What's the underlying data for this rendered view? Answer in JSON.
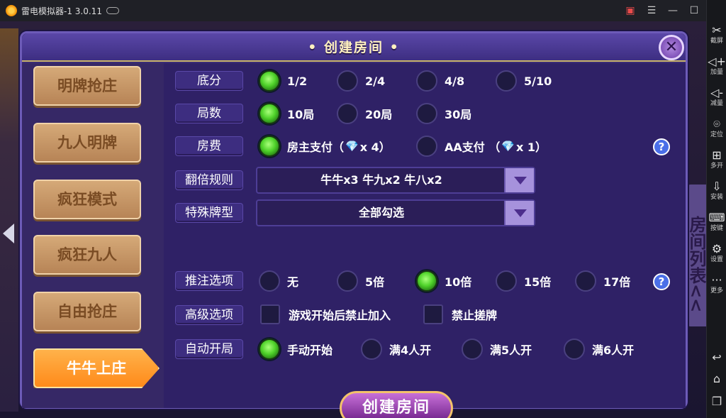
{
  "window": {
    "title": "雷电模拟器-1 3.0.11"
  },
  "dialog": {
    "title": "• 创建房间 •",
    "close_label": "✕",
    "create_button": "创建房间"
  },
  "background": {
    "side_panel_text": "房间列表<<"
  },
  "sidebar": {
    "items": [
      {
        "label": "明牌抢庄",
        "active": false
      },
      {
        "label": "九人明牌",
        "active": false
      },
      {
        "label": "疯狂模式",
        "active": false
      },
      {
        "label": "疯狂九人",
        "active": false
      },
      {
        "label": "自由抢庄",
        "active": false
      },
      {
        "label": "牛牛上庄",
        "active": true
      }
    ]
  },
  "form": {
    "base_score": {
      "label": "底分",
      "options": [
        "1/2",
        "2/4",
        "4/8",
        "5/10"
      ],
      "selected": "1/2"
    },
    "rounds": {
      "label": "局数",
      "options": [
        "10局",
        "20局",
        "30局"
      ],
      "selected": "10局"
    },
    "fee": {
      "label": "房费",
      "options": [
        {
          "text": "房主支付（",
          "gem": "💎",
          "mult": "x 4）"
        },
        {
          "text": "AA支付 （",
          "gem": "💎",
          "mult": "x 1）"
        }
      ],
      "selected": "房主支付",
      "help": "?"
    },
    "double_rule": {
      "label": "翻倍规则",
      "value": "牛牛x3  牛九x2  牛八x2"
    },
    "special": {
      "label": "特殊牌型",
      "value": "全部勾选"
    },
    "bet": {
      "label": "推注选项",
      "options": [
        "无",
        "5倍",
        "10倍",
        "15倍",
        "17倍"
      ],
      "selected": "10倍",
      "help": "?"
    },
    "advanced": {
      "label": "高级选项",
      "options": [
        {
          "label": "游戏开始后禁止加入",
          "checked": false
        },
        {
          "label": "禁止搓牌",
          "checked": false
        }
      ]
    },
    "auto_start": {
      "label": "自动开局",
      "options": [
        "手动开始",
        "满4人开",
        "满5人开",
        "满6人开"
      ],
      "selected": "手动开始"
    }
  },
  "rightbar": {
    "items": [
      {
        "icon": "scissors-icon",
        "label": "截屏"
      },
      {
        "icon": "volume-up-icon",
        "label": "加量"
      },
      {
        "icon": "volume-down-icon",
        "label": "减量"
      },
      {
        "icon": "location-icon",
        "label": "定位"
      },
      {
        "icon": "multi-open-icon",
        "label": "多开"
      },
      {
        "icon": "apk-install-icon",
        "label": "安装"
      },
      {
        "icon": "keyboard-icon",
        "label": "按键"
      },
      {
        "icon": "settings-icon",
        "label": "设置"
      },
      {
        "icon": "more-icon",
        "label": "更多"
      }
    ]
  },
  "colors": {
    "dialog_bg": "#3b2c76",
    "active_tab": "#ff9a2a",
    "radio_on": "#4fd22a",
    "title_text": "#fff1c0"
  }
}
